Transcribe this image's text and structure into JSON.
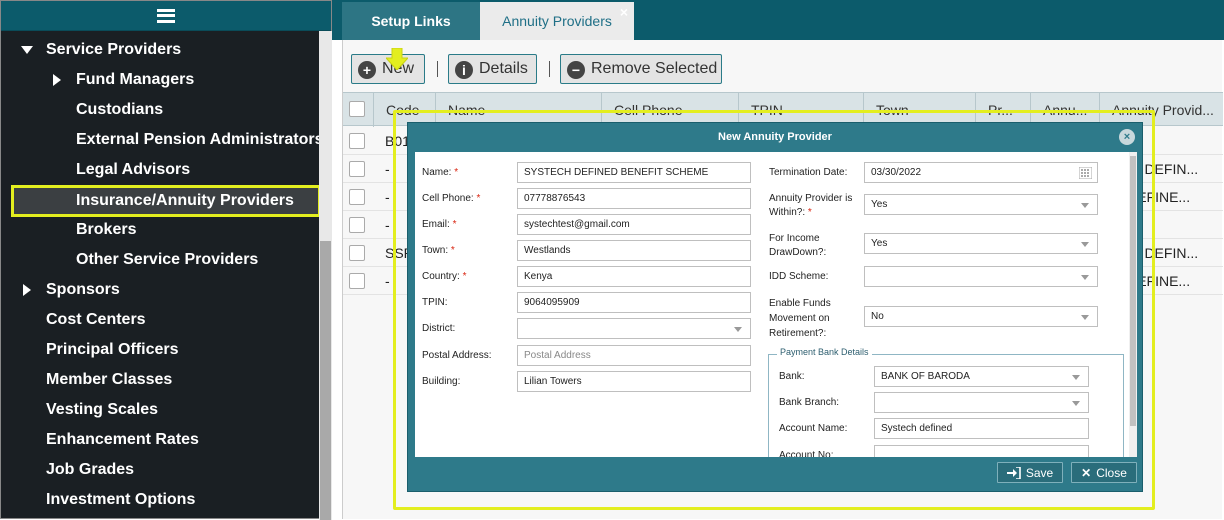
{
  "sidebar": {
    "items": [
      {
        "label": "Service Providers",
        "indent": 0,
        "arrow": "down"
      },
      {
        "label": "Fund Managers",
        "indent": 1,
        "arrow": "right"
      },
      {
        "label": "Custodians",
        "indent": 1,
        "arrow": ""
      },
      {
        "label": "External Pension Administrators",
        "indent": 1,
        "arrow": ""
      },
      {
        "label": "Legal Advisors",
        "indent": 1,
        "arrow": ""
      },
      {
        "label": "Insurance/Annuity Providers",
        "indent": 1,
        "arrow": "",
        "selected": true
      },
      {
        "label": "Brokers",
        "indent": 1,
        "arrow": ""
      },
      {
        "label": "Other Service Providers",
        "indent": 1,
        "arrow": ""
      },
      {
        "label": "Sponsors",
        "indent": 0,
        "arrow": "right"
      },
      {
        "label": "Cost Centers",
        "indent": 0,
        "arrow": ""
      },
      {
        "label": "Principal Officers",
        "indent": 0,
        "arrow": ""
      },
      {
        "label": "Member Classes",
        "indent": 0,
        "arrow": ""
      },
      {
        "label": "Vesting Scales",
        "indent": 0,
        "arrow": ""
      },
      {
        "label": "Enhancement Rates",
        "indent": 0,
        "arrow": ""
      },
      {
        "label": "Job Grades",
        "indent": 0,
        "arrow": ""
      },
      {
        "label": "Investment Options",
        "indent": 0,
        "arrow": ""
      }
    ]
  },
  "tabs": {
    "setup": "Setup Links",
    "annuity": "Annuity Providers",
    "close": "×"
  },
  "toolbar": {
    "new_label": "New",
    "details_label": "Details",
    "remove_label": "Remove Selected"
  },
  "grid": {
    "headers": [
      "Code",
      "Name",
      "Cell Phone",
      "TPIN",
      "Town",
      "Pr...",
      "Annu...",
      "Annuity Provid..."
    ],
    "rows": [
      {
        "code": "B01",
        "provider": ""
      },
      {
        "code": "-",
        "provider": "ECH DEFIN..."
      },
      {
        "code": "-",
        "provider": "IT DEFINE..."
      },
      {
        "code": "-",
        "provider": ""
      },
      {
        "code": "SSP",
        "provider": "ECH DEFIN..."
      },
      {
        "code": "-",
        "provider": "IT DEFINE..."
      }
    ]
  },
  "modal": {
    "title": "New Annuity Provider",
    "close": "×",
    "left": {
      "name_label": "Name:",
      "name_value": "SYSTECH DEFINED BENEFIT SCHEME",
      "cell_label": "Cell Phone:",
      "cell_value": "07778876543",
      "email_label": "Email:",
      "email_value": "systechtest@gmail.com",
      "town_label": "Town:",
      "town_value": "Westlands",
      "country_label": "Country:",
      "country_value": "Kenya",
      "tpin_label": "TPIN:",
      "tpin_value": "9064095909",
      "district_label": "District:",
      "district_value": "",
      "postal_label": "Postal Address:",
      "postal_placeholder": "Postal Address",
      "building_label": "Building:",
      "building_value": "Lilian Towers"
    },
    "right": {
      "term_label": "Termination Date:",
      "term_value": "03/30/2022",
      "within_label_1": "Annuity Provider is",
      "within_label_2": "Within?:",
      "within_value": "Yes",
      "drawdown_label_1": "For Income",
      "drawdown_label_2": "DrawDown?:",
      "drawdown_value": "Yes",
      "idd_label": "IDD Scheme:",
      "idd_value": "",
      "funds_label_1": "Enable Funds",
      "funds_label_2": "Movement on",
      "funds_label_3": "Retirement?:",
      "funds_value": "No"
    },
    "bank": {
      "legend": "Payment Bank Details",
      "bank_label": "Bank:",
      "bank_value": "BANK OF BARODA",
      "branch_label": "Bank Branch:",
      "branch_value": "",
      "acct_name_label": "Account Name:",
      "acct_name_value": "Systech defined",
      "acct_no_label": "Account No:",
      "acct_no_value": ""
    },
    "save_label": "Save",
    "close_label": "Close",
    "required_mark": "*"
  },
  "colors": {
    "accent": "#0c5b6b",
    "highlight": "#e3ee1f",
    "sidebar_bg": "#1a1f23"
  }
}
